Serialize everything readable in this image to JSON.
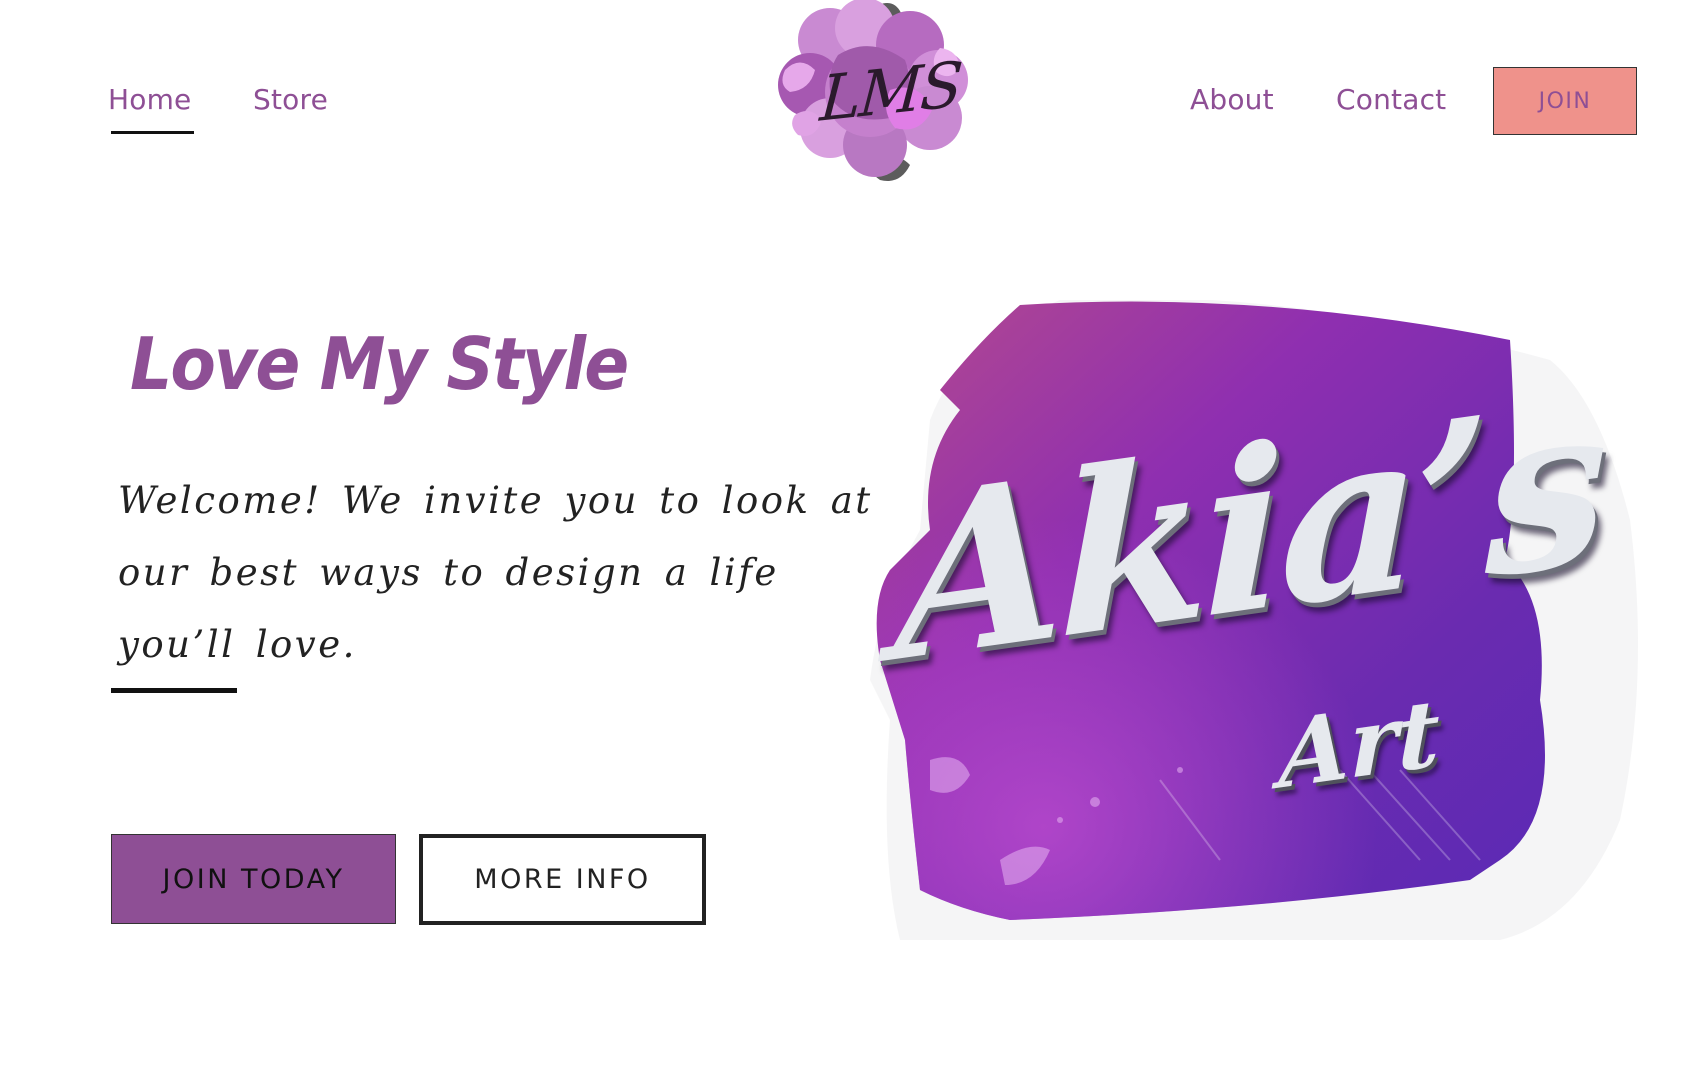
{
  "nav": {
    "home": "Home",
    "store": "Store",
    "about": "About",
    "contact": "Contact",
    "join": "JOIN"
  },
  "logo": {
    "text": "LMS"
  },
  "hero": {
    "title": "Love My Style",
    "body": "Welcome! We invite you to look at our best ways to design a life you’ll love.",
    "join_today": "JOIN TODAY",
    "more_info": "MORE INFO"
  },
  "art": {
    "word_1": "Akia’s",
    "word_2": "Art"
  },
  "colors": {
    "brand_purple": "#8e4f95",
    "join_pink": "#ef928b",
    "text_dark": "#222222"
  }
}
